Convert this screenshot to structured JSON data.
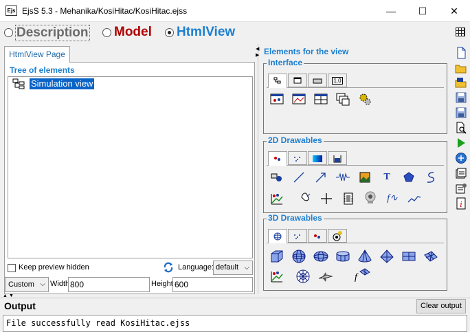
{
  "window": {
    "app_icon_text": "Ejs",
    "title": "EjsS 5.3 - Mehanika/KosiHitac/KosiHitac.ejss",
    "minimize_glyph": "—",
    "maximize_glyph": "☐",
    "close_glyph": "✕"
  },
  "modes": [
    {
      "label": "Description",
      "selected": false
    },
    {
      "label": "Model",
      "selected": false
    },
    {
      "label": "HtmlView",
      "selected": true
    }
  ],
  "left": {
    "tab_label": "HtmlView Page",
    "tree_header": "Tree of elements",
    "tree_root": "Simulation view",
    "keep_preview_label": "Keep preview hidden",
    "language_label": "Language:",
    "language_value": "default",
    "size_mode": "Custom",
    "width_label": "Width",
    "width_value": "800",
    "height_label": "Height",
    "height_value": "600"
  },
  "palette": {
    "title": "Elements for the view",
    "interface": {
      "label": "Interface",
      "tabs": [
        "panel-tab-icon",
        "window-tab-icon",
        "button-tab-icon",
        "number-field-tab-icon"
      ],
      "number_tab_text": "1.0",
      "items": [
        "drawing-panel-icon",
        "plotting-panel-icon",
        "panel-icon",
        "windows-icon",
        "gears-icon"
      ]
    },
    "drawables2d": {
      "label": "2D Drawables",
      "text_glyph": "T",
      "row1": [
        "shape-icon",
        "segment-icon",
        "arrow-icon",
        "spring-icon",
        "image-icon",
        "text-icon",
        "polygon-icon",
        "trail-icon"
      ],
      "row2": [
        "trace-icon",
        "hand-icon",
        "cross-icon",
        "film-icon",
        "camera-icon",
        "function-icon",
        "curve-icon"
      ],
      "func_glyph": "f∿"
    },
    "drawables3d": {
      "label": "3D Drawables",
      "row1": [
        "box-icon",
        "sphere-icon",
        "ellipsoid-icon",
        "cylinder-icon",
        "cone-icon",
        "tetrahedron-icon",
        "plane-icon",
        "surface-icon"
      ],
      "row2": [
        "trace3d-icon",
        "mesh-sphere-icon",
        "shuttle-icon",
        "function3d-icon"
      ],
      "func3d_glyph": "f"
    }
  },
  "colors": {
    "accent_blue": "#1e7fcf",
    "model_red": "#b00000",
    "selection": "#0a63c7"
  },
  "output": {
    "title": "Output",
    "clear_label": "Clear output",
    "text": "File successfully read KosiHitac.ejss"
  }
}
